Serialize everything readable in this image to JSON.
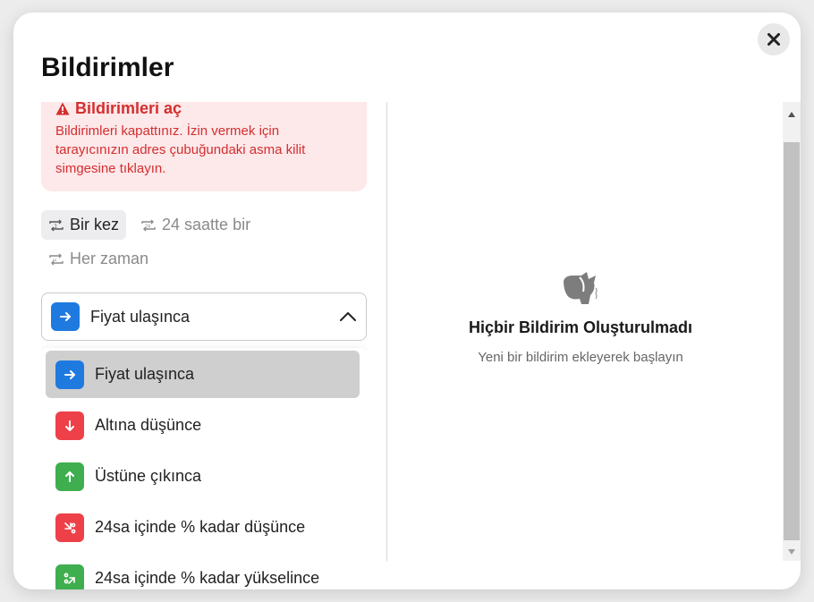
{
  "modal": {
    "title": "Bildirimler",
    "close_icon": "close-icon"
  },
  "alert": {
    "heading": "Bildirimleri aç",
    "message": "Bildirimleri kapattınız. İzin vermek için tarayıcınızın adres çubuğundaki asma kilit simgesine tıklayın.",
    "icon": "warning-icon",
    "color": "#d32f2f",
    "background": "#fde8ea"
  },
  "frequency": {
    "options": [
      {
        "label": "Bir kez",
        "icon": "repeat-once-icon",
        "active": true
      },
      {
        "label": "24 saatte bir",
        "icon": "repeat-24-icon",
        "active": false
      },
      {
        "label": "Her zaman",
        "icon": "repeat-infinite-icon",
        "active": false
      }
    ]
  },
  "condition_select": {
    "selected_label": "Fiyat ulaşınca",
    "selected_icon": "arrow-right-icon",
    "chevron_icon": "chevron-up-icon",
    "options": [
      {
        "label": "Fiyat ulaşınca",
        "icon": "arrow-right-icon",
        "color": "#1f7ae0",
        "selected": true
      },
      {
        "label": "Altına düşünce",
        "icon": "arrow-down-icon",
        "color": "#ee4048",
        "selected": false
      },
      {
        "label": "Üstüne çıkınca",
        "icon": "arrow-up-icon",
        "color": "#3fae4f",
        "selected": false
      },
      {
        "label": "24sa içinde % kadar düşünce",
        "icon": "percent-down-icon",
        "color": "#ee4048",
        "selected": false
      },
      {
        "label": "24sa içinde % kadar yükselince",
        "icon": "percent-up-icon",
        "color": "#3fae4f",
        "selected": false
      }
    ]
  },
  "empty_state": {
    "icon": "empty-notification-icon",
    "title": "Hiçbir Bildirim Oluşturulmadı",
    "subtitle": "Yeni bir bildirim ekleyerek başlayın"
  },
  "colors": {
    "accent_blue": "#1f7ae0",
    "danger_red": "#ee4048",
    "success_green": "#3fae4f"
  }
}
